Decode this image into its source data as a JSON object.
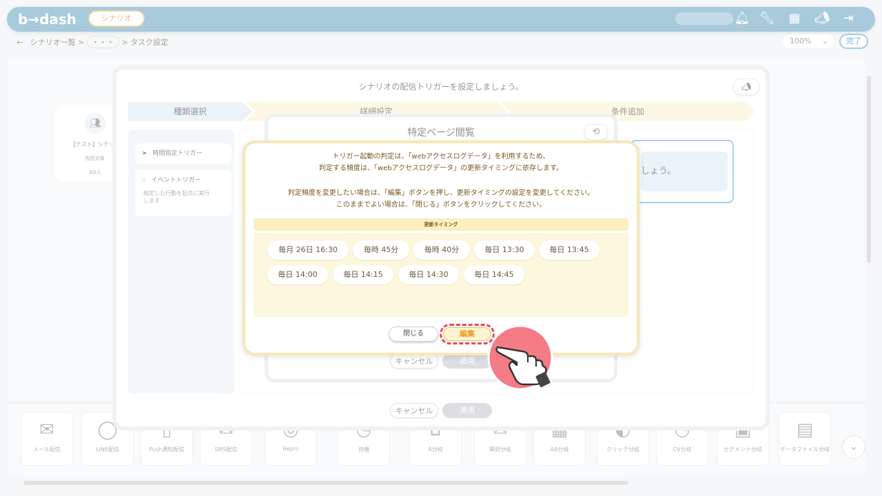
{
  "app": {
    "logo": "b→dash",
    "scenario_button": "シナリオ",
    "breadcrumbs": [
      "シナリオ一覧 >",
      "・・・",
      "> タスク設定"
    ],
    "zoom": "100%",
    "done": "完了"
  },
  "background": {
    "card_title": "【テスト】シナリオ",
    "card_sub": "配信対象",
    "card_count": "40人"
  },
  "tools": [
    {
      "icon": "mail-icon",
      "glyph": "✉",
      "label": "メール配信"
    },
    {
      "icon": "line-icon",
      "glyph": "◯",
      "label": "LINE配信"
    },
    {
      "icon": "push-icon",
      "glyph": "▯",
      "label": "Push通知配信"
    },
    {
      "icon": "sms-icon",
      "glyph": "✉",
      "label": "SMS配信"
    },
    {
      "icon": "repro-icon",
      "glyph": "◎",
      "label": "Repro"
    },
    {
      "icon": "clock-icon",
      "glyph": "◷",
      "label": "待機"
    },
    {
      "icon": "attr-branch-icon",
      "glyph": "⌂",
      "label": "A分岐"
    },
    {
      "icon": "open-branch-icon",
      "glyph": "✉",
      "label": "開封分岐"
    },
    {
      "icon": "ab-branch-icon",
      "glyph": "▦",
      "label": "AB分岐"
    },
    {
      "icon": "click-branch-icon",
      "glyph": "◐",
      "label": "クリック分岐"
    },
    {
      "icon": "cv-branch-icon",
      "glyph": "◔",
      "label": "CV分岐"
    },
    {
      "icon": "segment-branch-icon",
      "glyph": "▣",
      "label": "セグメント分岐"
    },
    {
      "icon": "data-file-branch-icon",
      "glyph": "▤",
      "label": "データファイル分岐"
    }
  ],
  "big_modal": {
    "title": "シナリオの配信トリガーを設定しましょう。",
    "steps": [
      "種類選択",
      "詳細設定",
      "条件追加"
    ],
    "triggers": [
      "時間指定トリガー",
      "イベントトリガー"
    ],
    "event_desc": "指定した行動を起点に実行します",
    "hint": "しょう。",
    "cancel": "キャンセル",
    "apply": "適用"
  },
  "mid_modal": {
    "title": "特定ページ閲覧",
    "cancel": "キャンセル",
    "apply": "適用"
  },
  "dialog": {
    "line1": "トリガー起動の判定は、「webアクセスログデータ」を利用するため、",
    "line2": "判定する頻度は、「webアクセスログデータ」の更新タイミングに依存します。",
    "line3": "判定頻度を変更したい場合は、「編集」ボタンを押し、更新タイミングの設定を変更してください。",
    "line4": "このままでよい場合は、「閉じる」ボタンをクリックしてください。",
    "timing_header": "更新タイミング",
    "timings": [
      "毎月 26日 16:30",
      "毎時 45分",
      "毎時 40分",
      "毎日 13:30",
      "毎日 13:45",
      "毎日 14:00",
      "毎日 14:15",
      "毎日 14:30",
      "毎日 14:45"
    ],
    "close": "閉じる",
    "edit": "編集"
  },
  "colors": {
    "brand": "#5f9fbf",
    "dialog_border": "#f7e8b8",
    "dialog_text": "#7a5a20",
    "highlight": "#e64a5a"
  }
}
